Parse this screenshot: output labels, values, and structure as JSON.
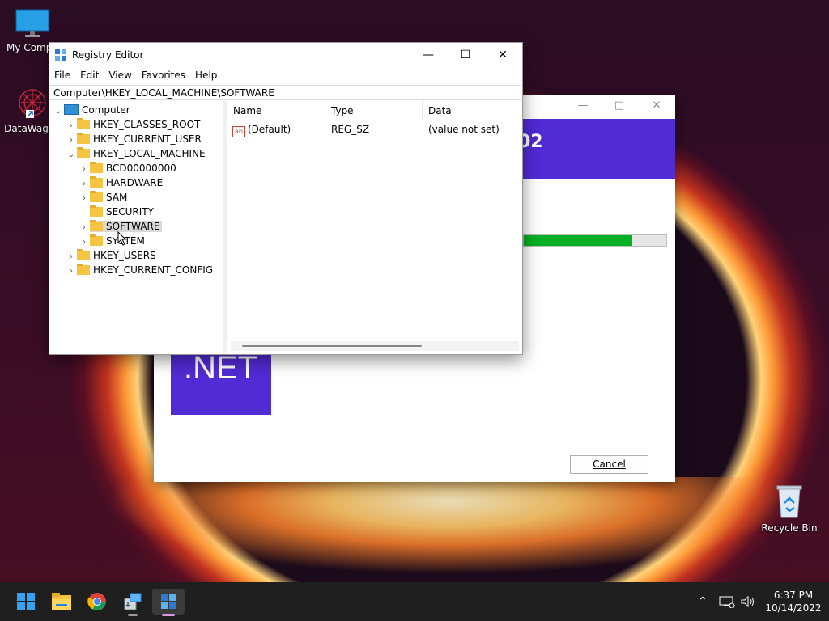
{
  "desktop": {
    "icons": [
      {
        "label": "My Compu",
        "icon": "monitor-icon"
      },
      {
        "label": "DataWagon",
        "icon": "datawagon-icon"
      },
      {
        "label": "Recycle Bin",
        "icon": "recycle-bin-icon"
      }
    ]
  },
  "installer": {
    "banner_fragment": "02",
    "progress_fraction": 0.76,
    "logo_text": ".NET",
    "cancel_label": "Cancel",
    "accent": "#512bd4",
    "progress_color": "#06b025"
  },
  "regedit": {
    "title": "Registry Editor",
    "menu": [
      "File",
      "Edit",
      "View",
      "Favorites",
      "Help"
    ],
    "address": "Computer\\HKEY_LOCAL_MACHINE\\SOFTWARE",
    "tree": {
      "root": "Computer",
      "hives": [
        "HKEY_CLASSES_ROOT",
        "HKEY_CURRENT_USER",
        "HKEY_LOCAL_MACHINE",
        "HKEY_USERS",
        "HKEY_CURRENT_CONFIG"
      ],
      "hklm_children": [
        "BCD00000000",
        "HARDWARE",
        "SAM",
        "SECURITY",
        "SOFTWARE",
        "SYSTEM"
      ],
      "selected": "SOFTWARE"
    },
    "columns": [
      "Name",
      "Type",
      "Data"
    ],
    "values": [
      {
        "name": "(Default)",
        "type": "REG_SZ",
        "data": "(value not set)"
      }
    ]
  },
  "taskbar": {
    "apps": [
      "start-icon",
      "file-explorer-icon",
      "chrome-icon",
      "installer-icon",
      "registry-editor-icon"
    ],
    "time": "6:37 PM",
    "date": "10/14/2022"
  }
}
